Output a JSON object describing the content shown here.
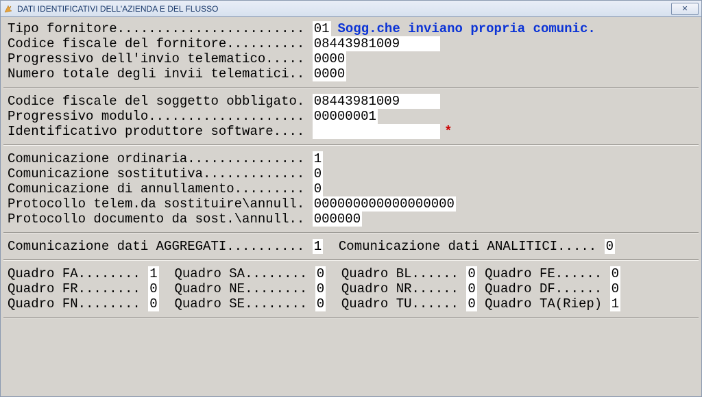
{
  "window": {
    "title": "DATI IDENTIFICATIVI DELL'AZIENDA E DEL FLUSSO",
    "close_glyph": "✕"
  },
  "section1": {
    "tipo_fornitore_label": "Tipo fornitore........................ ",
    "tipo_fornitore_value": "01",
    "tipo_fornitore_desc": "Sogg.che inviano propria comunic.",
    "cf_fornitore_label": "Codice fiscale del fornitore.......... ",
    "cf_fornitore_value": "08443981009     ",
    "prog_invio_label": "Progressivo dell'invio telematico..... ",
    "prog_invio_value": "0000",
    "num_tot_invii_label": "Numero totale degli invii telematici.. ",
    "num_tot_invii_value": "0000"
  },
  "section2": {
    "cf_soggetto_label": "Codice fiscale del soggetto obbligato. ",
    "cf_soggetto_value": "08443981009     ",
    "prog_modulo_label": "Progressivo modulo.................... ",
    "prog_modulo_value": "00000001",
    "id_prod_sw_label": "Identificativo produttore software.... ",
    "id_prod_sw_value": "                ",
    "req": "*"
  },
  "section3": {
    "com_ord_label": "Comunicazione ordinaria............... ",
    "com_ord_value": "1",
    "com_sost_label": "Comunicazione sostitutiva............. ",
    "com_sost_value": "0",
    "com_ann_label": "Comunicazione di annullamento......... ",
    "com_ann_value": "0",
    "prot_telem_label": "Protocollo telem.da sostituire\\annull. ",
    "prot_telem_value": "000000000000000000",
    "prot_doc_label": "Protocollo documento da sost.\\annull.. ",
    "prot_doc_value": "000000"
  },
  "section4": {
    "agg_label": "Comunicazione dati AGGREGATI.......... ",
    "agg_value": "1",
    "ana_label": "Comunicazione dati ANALITICI..... ",
    "ana_value": "0"
  },
  "quadri": {
    "r1c1l": "Quadro FA........ ",
    "r1c1v": "1",
    "r1c2l": "Quadro SA........ ",
    "r1c2v": "0",
    "r1c3l": "Quadro BL...... ",
    "r1c3v": "0",
    "r1c4l": "Quadro FE...... ",
    "r1c4v": "0",
    "r2c1l": "Quadro FR........ ",
    "r2c1v": "0",
    "r2c2l": "Quadro NE........ ",
    "r2c2v": "0",
    "r2c3l": "Quadro NR...... ",
    "r2c3v": "0",
    "r2c4l": "Quadro DF...... ",
    "r2c4v": "0",
    "r3c1l": "Quadro FN........ ",
    "r3c1v": "0",
    "r3c2l": "Quadro SE........ ",
    "r3c2v": "0",
    "r3c3l": "Quadro TU...... ",
    "r3c3v": "0",
    "r3c4l": "Quadro TA(Riep) ",
    "r3c4v": "1"
  }
}
